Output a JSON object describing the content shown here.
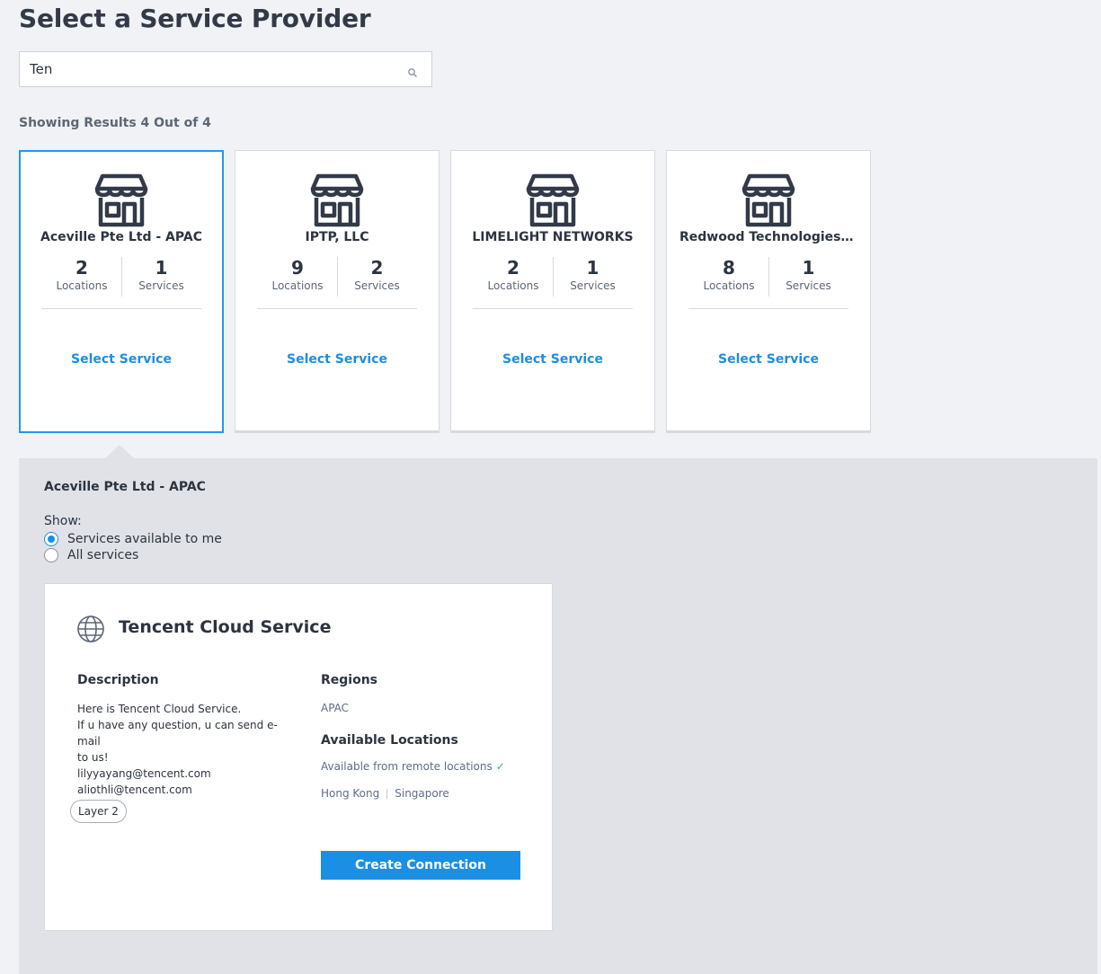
{
  "page": {
    "title": "Select a Service Provider",
    "results_text": "Showing Results 4 Out of 4"
  },
  "search": {
    "value": "Ten",
    "placeholder": ""
  },
  "providers": [
    {
      "name": "Aceville Pte Ltd - APAC",
      "locations": "2",
      "locations_label": "Locations",
      "services": "1",
      "services_label": "Services",
      "action": "Select Service",
      "selected": true
    },
    {
      "name": "IPTP, LLC",
      "locations": "9",
      "locations_label": "Locations",
      "services": "2",
      "services_label": "Services",
      "action": "Select Service",
      "selected": false
    },
    {
      "name": "LIMELIGHT NETWORKS",
      "locations": "2",
      "locations_label": "Locations",
      "services": "1",
      "services_label": "Services",
      "action": "Select Service",
      "selected": false
    },
    {
      "name": "Redwood Technologies ...",
      "locations": "8",
      "locations_label": "Locations",
      "services": "1",
      "services_label": "Services",
      "action": "Select Service",
      "selected": false
    }
  ],
  "detail": {
    "provider_name": "Aceville Pte Ltd - APAC",
    "show_label": "Show:",
    "options": [
      {
        "label": "Services available to me",
        "checked": true
      },
      {
        "label": "All services",
        "checked": false
      }
    ],
    "service": {
      "name": "Tencent Cloud Service",
      "icon": "globe-icon",
      "description_heading": "Description",
      "description_lines": [
        "Here is Tencent Cloud Service.",
        "If u have any question, u can send e-mail",
        "to us!",
        "lilyyayang@tencent.com",
        "aliothli@tencent.com"
      ],
      "tag": "Layer 2",
      "regions_heading": "Regions",
      "regions": "APAC",
      "locations_heading": "Available Locations",
      "remote_text": "Available from remote locations",
      "locations": [
        "Hong Kong",
        "Singapore"
      ],
      "button": "Create Connection"
    }
  },
  "colors": {
    "accent": "#1a8fe3",
    "selected_border": "#2196f3",
    "panel_bg": "#e0e2e7",
    "page_bg": "#f0f2f5",
    "check": "#2bb673"
  }
}
